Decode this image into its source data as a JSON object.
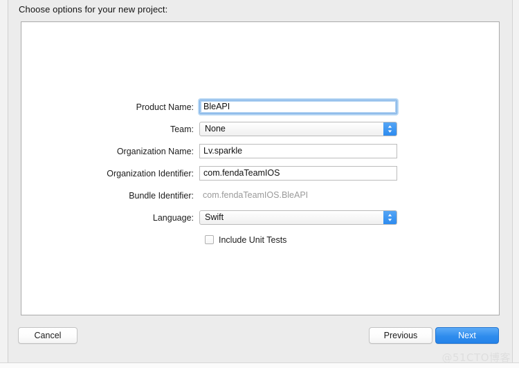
{
  "dialog": {
    "title": "Choose options for your new project:"
  },
  "form": {
    "rows": [
      {
        "label": "Product Name:",
        "type": "text",
        "value": "BleAPI",
        "focused": true,
        "name": "product-name"
      },
      {
        "label": "Team:",
        "type": "popup",
        "value": "None",
        "focused": false,
        "name": "team"
      },
      {
        "label": "Organization Name:",
        "type": "text",
        "value": "Lv.sparkle",
        "focused": false,
        "name": "organization-name"
      },
      {
        "label": "Organization Identifier:",
        "type": "text",
        "value": "com.fendaTeamIOS",
        "focused": false,
        "name": "organization-identifier"
      },
      {
        "label": "Bundle Identifier:",
        "type": "static",
        "value": "com.fendaTeamIOS.BleAPI",
        "focused": false,
        "name": "bundle-identifier"
      },
      {
        "label": "Language:",
        "type": "popup",
        "value": "Swift",
        "focused": false,
        "name": "language"
      }
    ],
    "checkbox": {
      "label": "Include Unit Tests",
      "checked": false
    }
  },
  "buttons": {
    "cancel": "Cancel",
    "previous": "Previous",
    "next": "Next"
  },
  "watermark": "@51CTO博客",
  "colors": {
    "accent": "#2f8ced",
    "window_background": "#ececec",
    "panel_background": "#ffffff",
    "field_border": "#bcbcbc",
    "focus_ring": "#bcdaf4",
    "static_text": "#9a9a9a",
    "watermark": "#dedede"
  }
}
